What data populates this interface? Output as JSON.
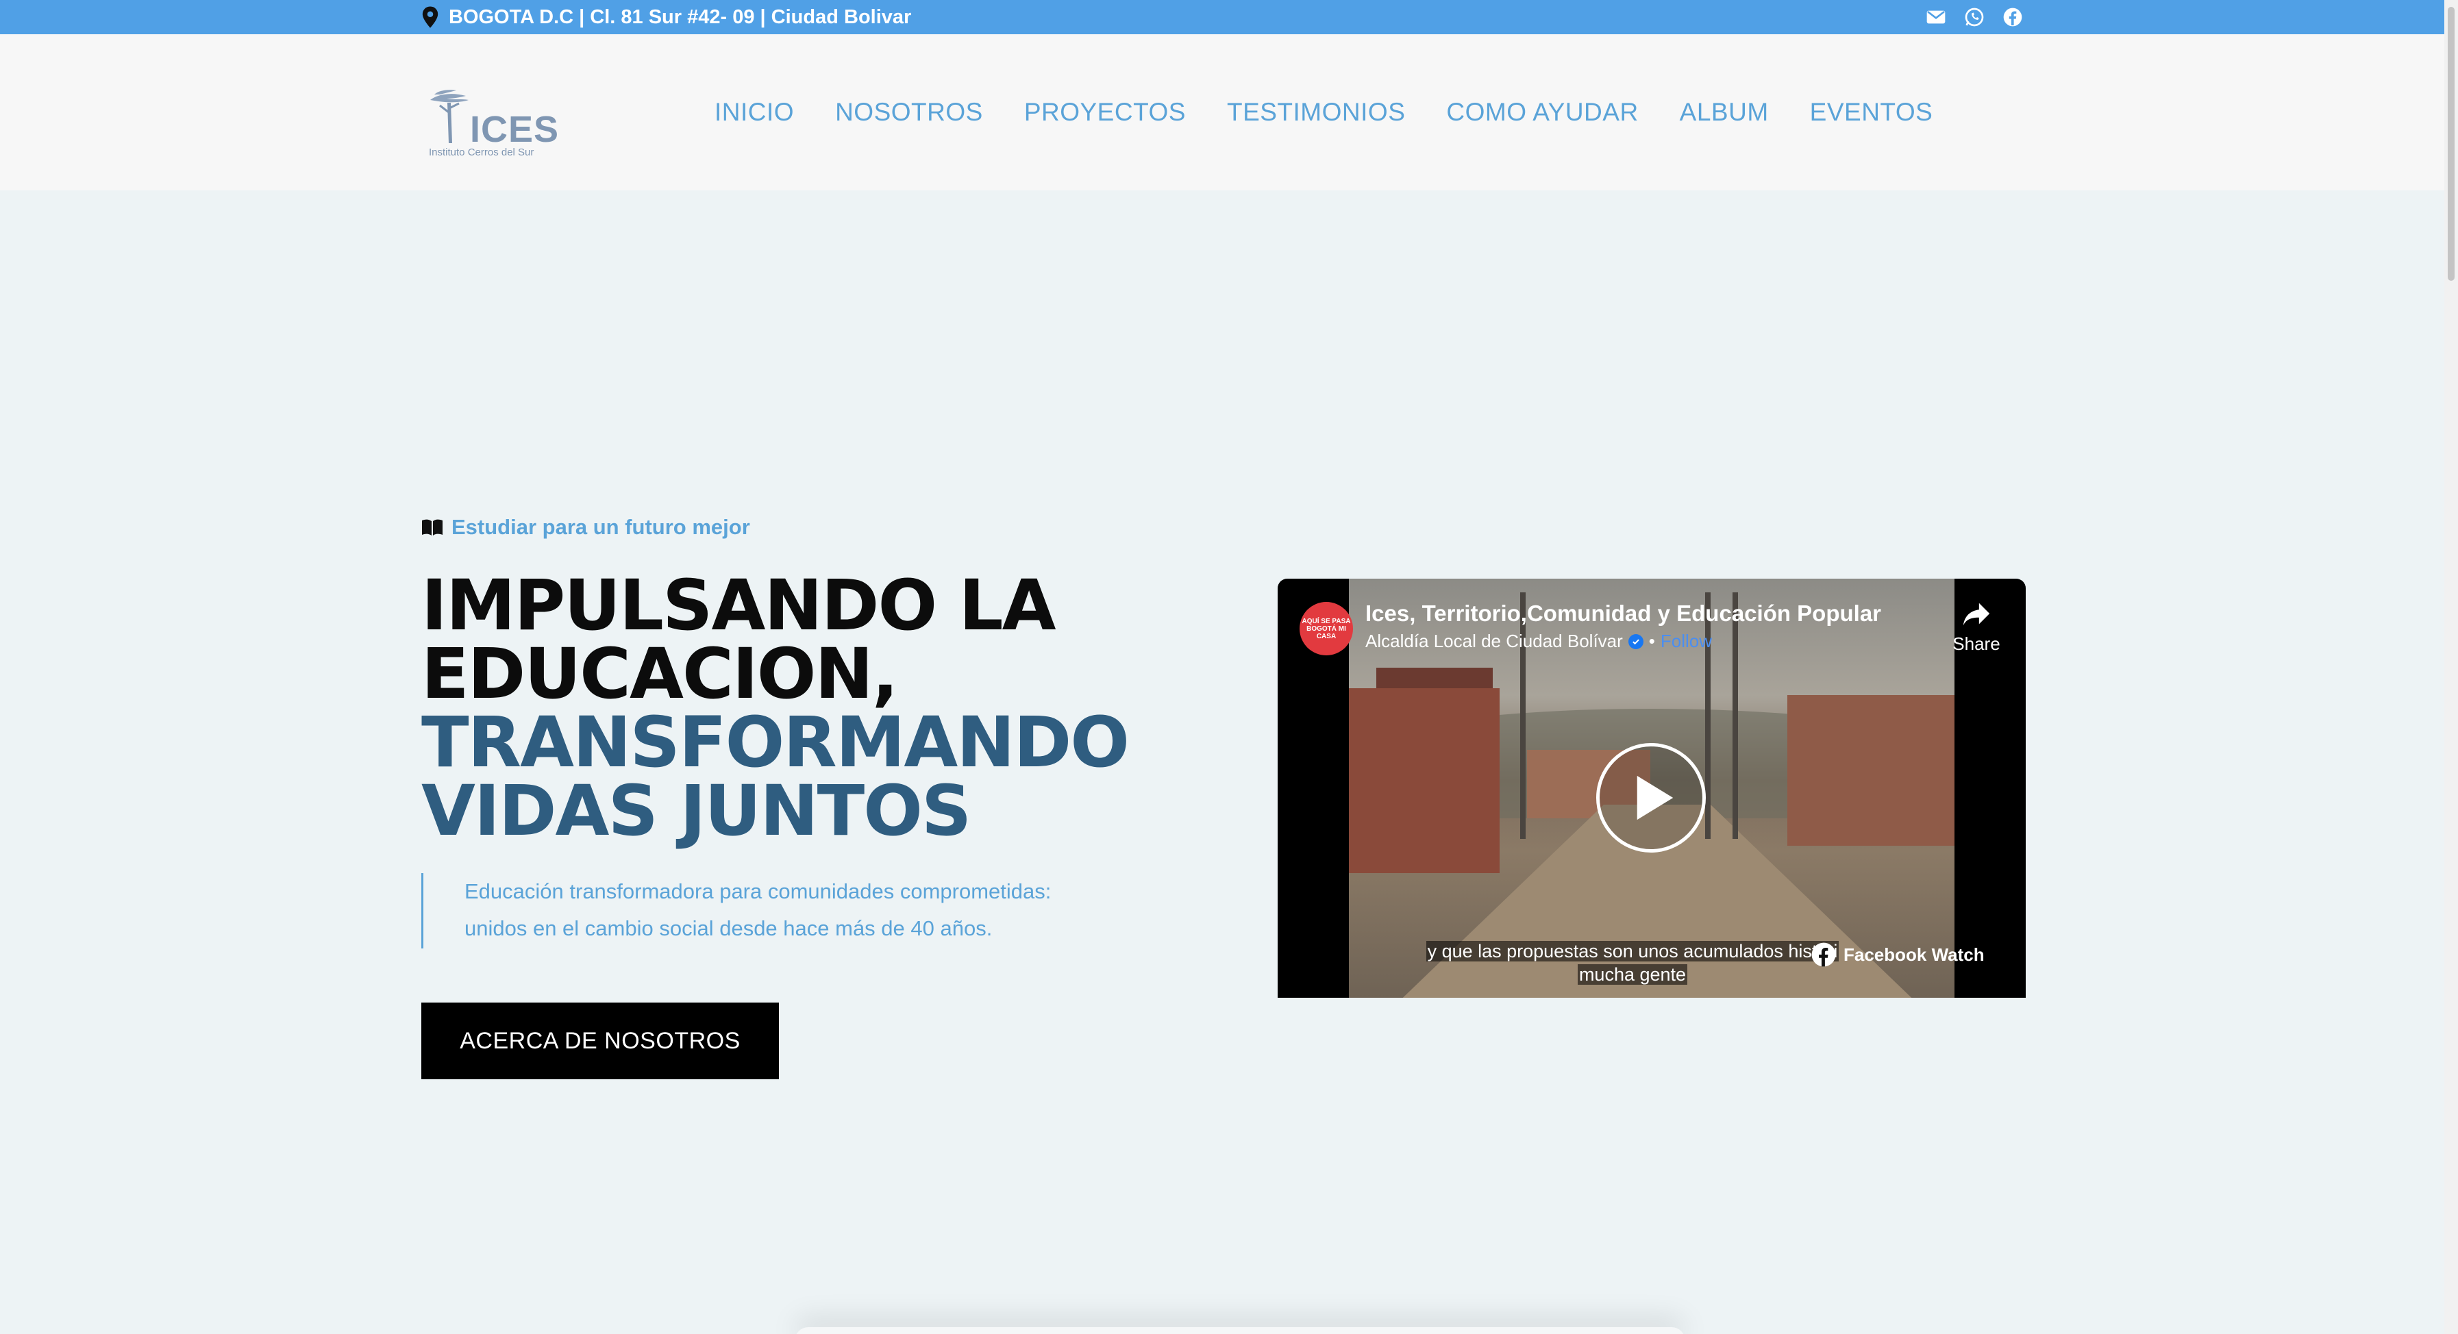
{
  "topbar": {
    "address": "BOGOTA D.C | Cl. 81 Sur #42- 09 | Ciudad Bolivar",
    "icons": [
      "location-pin-icon",
      "mail-icon",
      "whatsapp-icon",
      "facebook-icon"
    ]
  },
  "header": {
    "logo_text": "ICES",
    "logo_subtitle": "Instituto Cerros del Sur",
    "nav": [
      "INICIO",
      "NOSOTROS",
      "PROYECTOS",
      "TESTIMONIOS",
      "COMO AYUDAR",
      "ALBUM",
      "EVENTOS"
    ]
  },
  "hero": {
    "tagline": "Estudiar para un futuro mejor",
    "title_lines_dark": [
      "IMPULSANDO LA",
      "EDUCACION,"
    ],
    "title_lines_blue": [
      "TRANSFORMANDO",
      "VIDAS JUNTOS"
    ],
    "quote": "Educación transformadora para comunidades comprometidas: unidos en el cambio social desde hace más de 40 años.",
    "cta_label": "ACERCA DE NOSOTROS"
  },
  "video": {
    "title": "Ices, Territorio,Comunidad y Educación Popular",
    "channel": "Alcaldía Local de Ciudad Bolívar",
    "follow_label": "Follow",
    "share_label": "Share",
    "caption_line1": "y que las propuestas son unos acumulados históri",
    "caption_line2": "mucha gente",
    "watch_label": "Facebook Watch",
    "channel_logo_text": "AQUÍ SE PASA BOGOTÁ MI CASA"
  },
  "colors": {
    "topbar": "#50a0e6",
    "accent": "#5aa3d8",
    "title_blue": "#2f5d80",
    "background": "#edf3f5"
  }
}
